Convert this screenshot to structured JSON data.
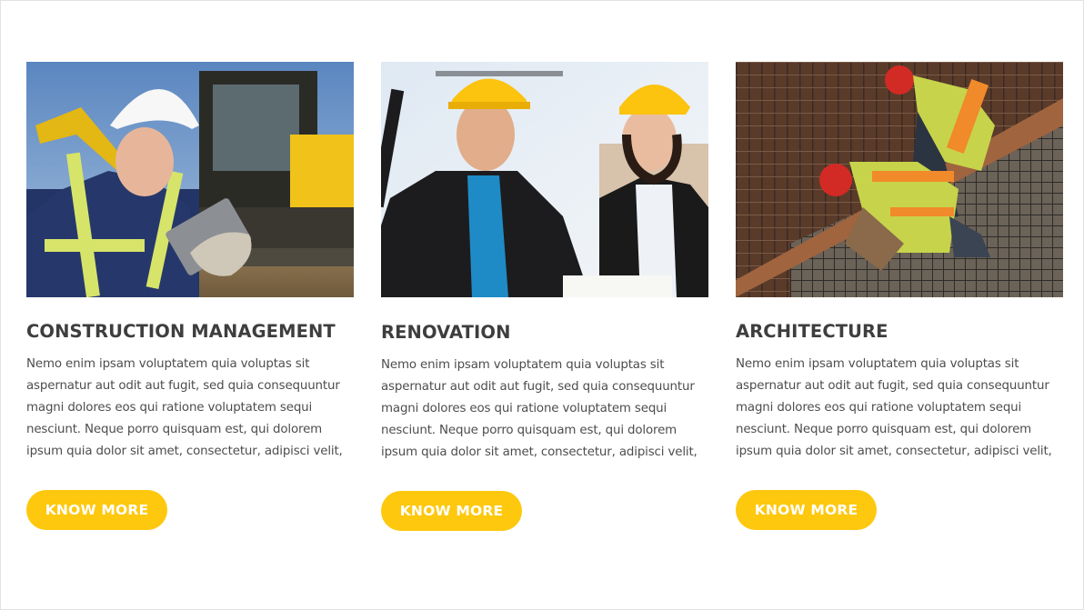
{
  "services": [
    {
      "image_alt": "Construction manager with tablet in front of excavator",
      "title": "CONSTRUCTION MANAGEMENT",
      "description_lines": [
        "Nemo enim ipsam voluptatem quia voluptas sit",
        "aspernatur aut odit aut fugit, sed quia consequuntur",
        "magni dolores eos qui ratione voluptatem sequi",
        "nesciunt. Neque porro quisquam est, qui dolorem",
        "ipsum quia dolor sit amet, consectetur, adipisci velit,"
      ],
      "button_label": "KNOW MORE"
    },
    {
      "image_alt": "Two engineers in yellow hard hats",
      "title": "RENOVATION",
      "description_lines": [
        "Nemo enim ipsam voluptatem quia voluptas sit",
        "aspernatur aut odit aut fugit, sed quia consequuntur",
        "magni dolores eos qui ratione voluptatem sequi",
        "nesciunt. Neque porro quisquam est, qui dolorem",
        "ipsum quia dolor sit amet, consectetur, adipisci velit,"
      ],
      "button_label": "KNOW MORE"
    },
    {
      "image_alt": "Workers tying rebar grid",
      "title": "ARCHITECTURE",
      "description_lines": [
        "Nemo enim ipsam voluptatem quia voluptas sit",
        "aspernatur aut odit aut fugit, sed quia consequuntur",
        "magni dolores eos qui ratione voluptatem sequi",
        "nesciunt. Neque porro quisquam est, qui dolorem",
        "ipsum quia dolor sit amet, consectetur, adipisci velit,"
      ],
      "button_label": "KNOW MORE"
    }
  ],
  "colors": {
    "accent": "#fdc80e",
    "heading": "#3e3e3e",
    "body_text": "#4d4d4d",
    "button_text": "#ffffff"
  }
}
